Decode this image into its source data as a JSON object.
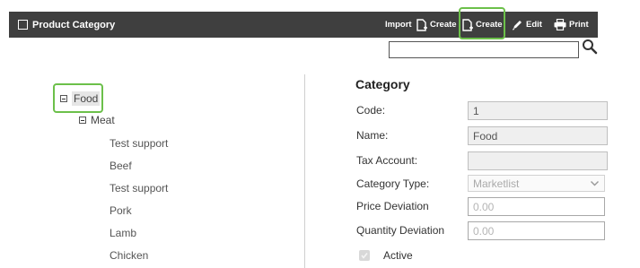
{
  "header": {
    "title": "Product Category",
    "toolbar": {
      "import_label": "Import",
      "create1_label": "Create",
      "create2_label": "Create",
      "edit_label": "Edit",
      "print_label": "Print"
    }
  },
  "search": {
    "value": "",
    "placeholder": ""
  },
  "tree": {
    "root": "Food",
    "group": "Meat",
    "leaves": [
      "Test support",
      "Beef",
      "Test support",
      "Pork",
      "Lamb",
      "Chicken"
    ]
  },
  "form": {
    "heading": "Category",
    "code_label": "Code:",
    "code_value": "1",
    "name_label": "Name:",
    "name_value": "Food",
    "tax_label": "Tax Account:",
    "tax_value": "",
    "type_label": "Category Type:",
    "type_value": "Marketlist",
    "price_label": "Price Deviation",
    "price_value": "0.00",
    "qty_label": "Quantity Deviation",
    "qty_value": "0.00",
    "active_label": "Active",
    "active_checked": true
  },
  "colors": {
    "titlebar": "#3f3f3f",
    "highlight": "#6cc04a"
  },
  "icons": [
    "document-icon",
    "create-icon",
    "edit-icon",
    "print-icon",
    "search-icon",
    "minus-box-icon",
    "chevron-down-icon",
    "checkmark-icon"
  ]
}
